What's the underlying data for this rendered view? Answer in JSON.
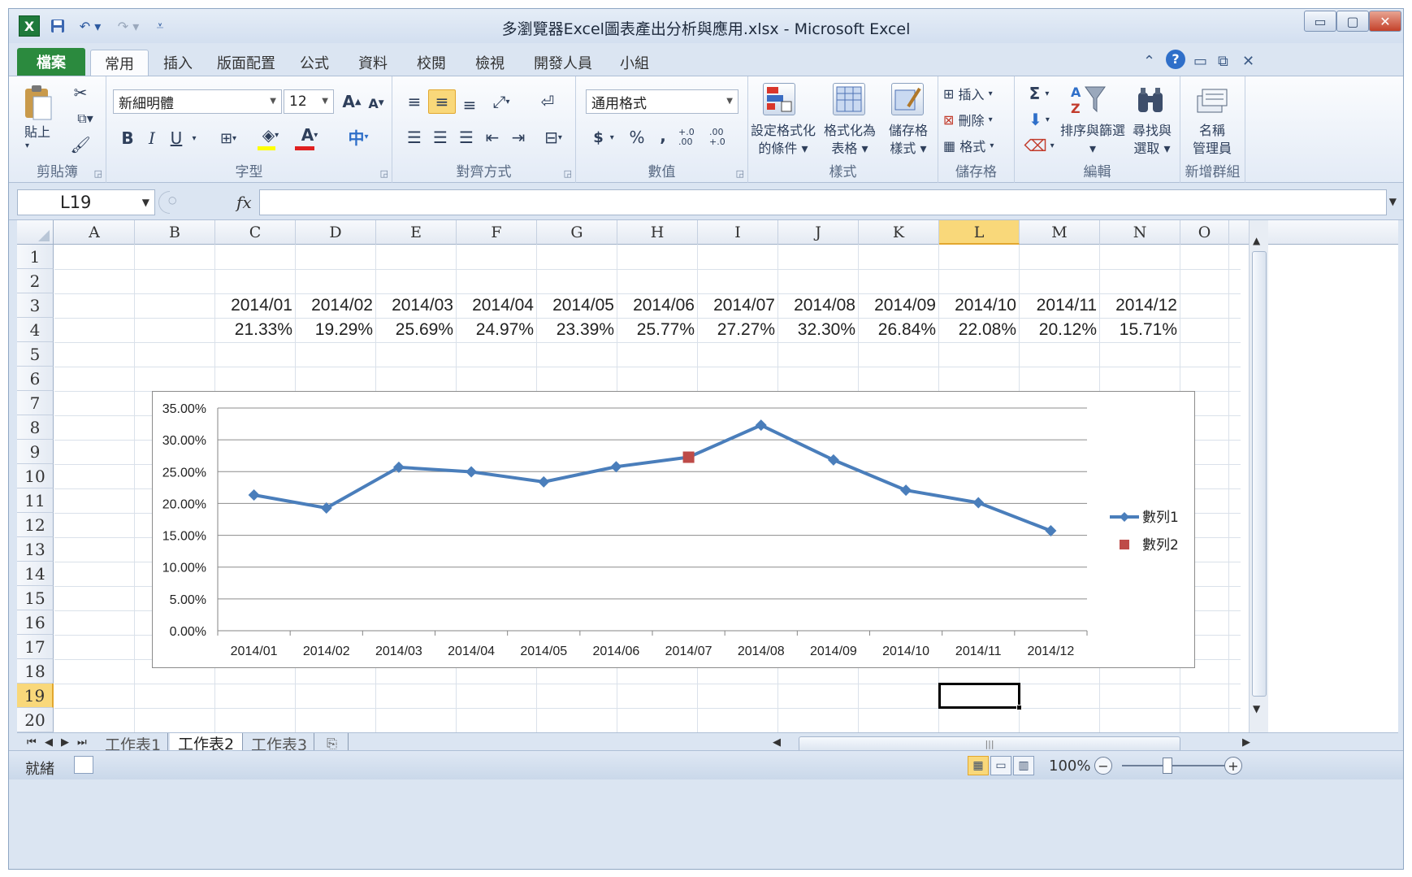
{
  "window": {
    "title": "多瀏覽器Excel圖表產出分析與應用.xlsx - Microsoft Excel",
    "app_icon": "X",
    "controls": {
      "minimize": "▭",
      "maximize": "▢",
      "close": "✕"
    }
  },
  "tabs": [
    {
      "label": "檔案"
    },
    {
      "label": "常用"
    },
    {
      "label": "插入"
    },
    {
      "label": "版面配置"
    },
    {
      "label": "公式"
    },
    {
      "label": "資料"
    },
    {
      "label": "校閱"
    },
    {
      "label": "檢視"
    },
    {
      "label": "開發人員"
    },
    {
      "label": "小組"
    }
  ],
  "ribbon": {
    "clipboard": {
      "paste": "貼上",
      "group": "剪貼簿"
    },
    "font": {
      "name": "新細明體",
      "size": "12",
      "group": "字型",
      "bold": "B",
      "italic": "I",
      "underline": "U",
      "grow": "A",
      "shrink": "A",
      "font_color_letter": "A",
      "phonetic": "中"
    },
    "alignment": {
      "group": "對齊方式"
    },
    "number": {
      "format": "通用格式",
      "group": "數值",
      "currency": "$",
      "percent": "%",
      "comma": ",",
      "inc_decimal": "+.0 .00",
      "dec_decimal": ".00 +.0"
    },
    "styles": {
      "conditional": [
        "設定格式化",
        "的條件"
      ],
      "as_table": [
        "格式化為",
        "表格"
      ],
      "cell_styles": [
        "儲存格",
        "樣式"
      ],
      "group": "樣式"
    },
    "cells": {
      "insert": "插入",
      "delete": "刪除",
      "format": "格式",
      "group": "儲存格"
    },
    "editing": {
      "sum": "Σ",
      "sort": "排序與篩選",
      "find": [
        "尋找與",
        "選取"
      ],
      "group": "編輯"
    },
    "names": {
      "manager": [
        "名稱",
        "管理員"
      ],
      "group": "新增群組"
    }
  },
  "formula_bar": {
    "name_box": "L19",
    "fx": "fx",
    "formula": ""
  },
  "columns": [
    "A",
    "B",
    "C",
    "D",
    "E",
    "F",
    "G",
    "H",
    "I",
    "J",
    "K",
    "L",
    "M",
    "N",
    "O"
  ],
  "rows": [
    "1",
    "2",
    "3",
    "4",
    "5",
    "6",
    "7",
    "8",
    "9",
    "10",
    "11",
    "12",
    "13",
    "14",
    "15",
    "16",
    "17",
    "18",
    "19",
    "20"
  ],
  "selected": {
    "column": "L",
    "row": "19"
  },
  "sheet": {
    "row3": [
      "2014/01",
      "2014/02",
      "2014/03",
      "2014/04",
      "2014/05",
      "2014/06",
      "2014/07",
      "2014/08",
      "2014/09",
      "2014/10",
      "2014/11",
      "2014/12"
    ],
    "row4": [
      "21.33%",
      "19.29%",
      "25.69%",
      "24.97%",
      "23.39%",
      "25.77%",
      "27.27%",
      "32.30%",
      "26.84%",
      "22.08%",
      "20.12%",
      "15.71%"
    ]
  },
  "chart_data": {
    "type": "line",
    "categories": [
      "2014/01",
      "2014/02",
      "2014/03",
      "2014/04",
      "2014/05",
      "2014/06",
      "2014/07",
      "2014/08",
      "2014/09",
      "2014/10",
      "2014/11",
      "2014/12"
    ],
    "series": [
      {
        "name": "數列1",
        "values": [
          21.33,
          19.29,
          25.69,
          24.97,
          23.39,
          25.77,
          27.27,
          32.3,
          26.84,
          22.08,
          20.12,
          15.71
        ],
        "color": "#4a7ebb",
        "marker": "diamond"
      },
      {
        "name": "數列2",
        "values": [
          null,
          null,
          null,
          null,
          null,
          null,
          27.27,
          null,
          null,
          null,
          null,
          null
        ],
        "color": "#be4b48",
        "marker": "square"
      }
    ],
    "yticks": [
      "0.00%",
      "5.00%",
      "10.00%",
      "15.00%",
      "20.00%",
      "25.00%",
      "30.00%",
      "35.00%"
    ],
    "ylim": [
      0,
      35
    ],
    "grid": true,
    "legend": "right"
  },
  "sheet_tabs": [
    "工作表1",
    "工作表2",
    "工作表3"
  ],
  "active_sheet": "工作表2",
  "status": {
    "text": "就緒",
    "zoom": "100%"
  }
}
